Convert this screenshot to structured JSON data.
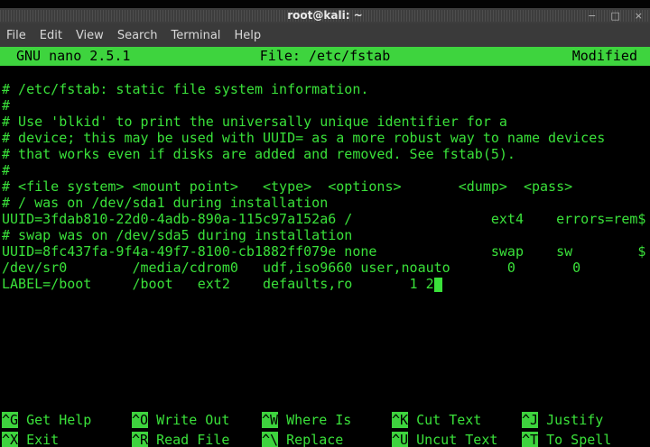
{
  "window": {
    "title": "root@kali: ~",
    "controls": {
      "minimize": "−",
      "maximize": "□",
      "close": "×"
    }
  },
  "menu": {
    "items": [
      "File",
      "Edit",
      "View",
      "Search",
      "Terminal",
      "Help"
    ]
  },
  "nano": {
    "version_label": "GNU nano 2.5.1",
    "file_label": "File: /etc/fstab",
    "modified_label": "Modified",
    "buffer_lines": [
      "",
      "# /etc/fstab: static file system information.",
      "#",
      "# Use 'blkid' to print the universally unique identifier for a",
      "# device; this may be used with UUID= as a more robust way to name devices",
      "# that works even if disks are added and removed. See fstab(5).",
      "#",
      "# <file system> <mount point>   <type>  <options>       <dump>  <pass>",
      "# / was on /dev/sda1 during installation",
      "UUID=3fdab810-22d0-4adb-890a-115c97a152a6 /                 ext4    errors=rem$",
      "# swap was on /dev/sda5 during installation",
      "UUID=8fc437fa-9f4a-49f7-8100-cb1882ff079e none              swap    sw        $",
      "/dev/sr0        /media/cdrom0   udf,iso9660 user,noauto       0       0",
      "LABEL=/boot     /boot   ext2    defaults,ro       1 2"
    ],
    "cursor_line_index": 13,
    "shortcuts_row1": [
      {
        "key": "^G",
        "label": "Get Help"
      },
      {
        "key": "^O",
        "label": "Write Out"
      },
      {
        "key": "^W",
        "label": "Where Is"
      },
      {
        "key": "^K",
        "label": "Cut Text"
      },
      {
        "key": "^J",
        "label": "Justify"
      }
    ],
    "shortcuts_row2": [
      {
        "key": "^X",
        "label": "Exit"
      },
      {
        "key": "^R",
        "label": "Read File"
      },
      {
        "key": "^\\",
        "label": "Replace"
      },
      {
        "key": "^U",
        "label": "Uncut Text"
      },
      {
        "key": "^T",
        "label": "To Spell"
      }
    ]
  },
  "colors": {
    "terminal_green": "#3ae13a",
    "nano_bar_green": "#3ed43e",
    "terminal_bg": "#000000",
    "titlebar_bg": "#3d3d3d",
    "menubar_bg": "#3a3a3a",
    "title_text": "#e9e9e9",
    "menu_text": "#d8d8d8",
    "control_icon": "#b5b5b5"
  }
}
